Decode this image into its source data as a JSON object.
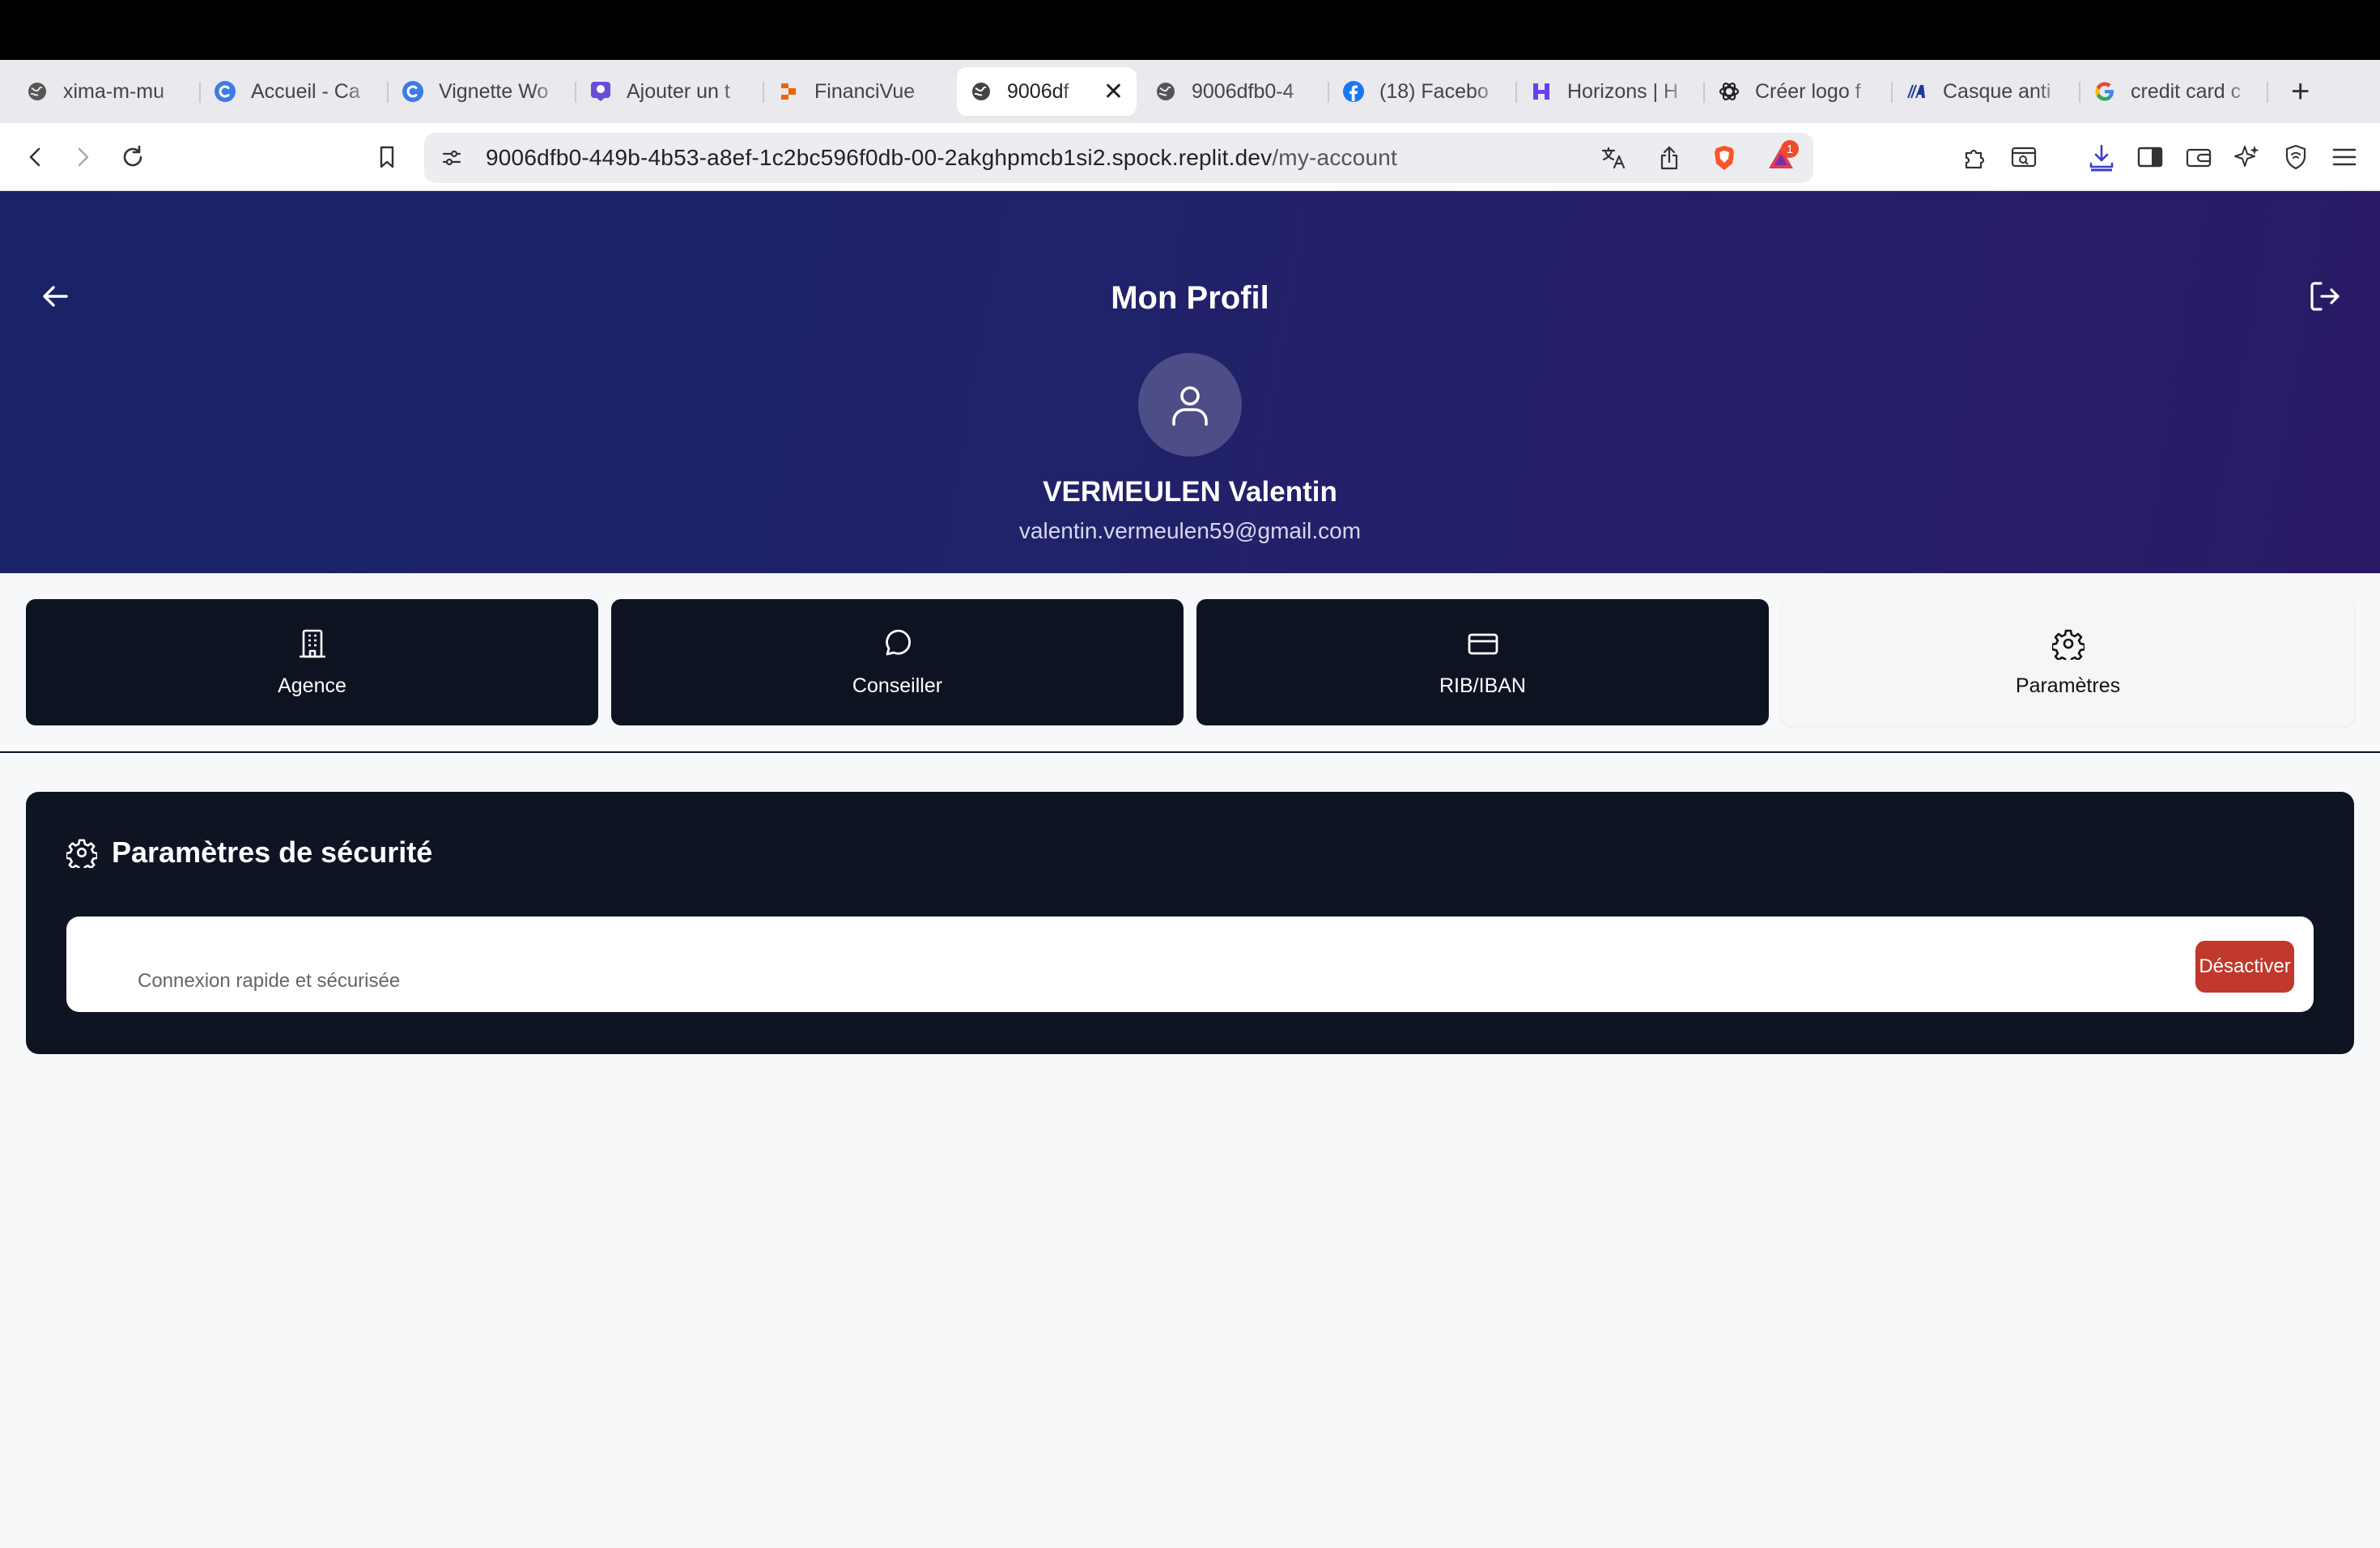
{
  "browser": {
    "tabs": [
      {
        "label": "xima-m-mu",
        "icon": "globe-icon"
      },
      {
        "label": "Accueil - Ca",
        "icon": "canva-icon"
      },
      {
        "label": "Vignette Wo",
        "icon": "canva-icon"
      },
      {
        "label": "Ajouter un t",
        "icon": "badge-icon"
      },
      {
        "label": "FinanciVue",
        "icon": "replit-icon"
      },
      {
        "label": "9006df",
        "icon": "globe-icon",
        "active": true
      },
      {
        "label": "9006dfb0-4",
        "icon": "globe-icon"
      },
      {
        "label": "(18) Facebo",
        "icon": "facebook-icon"
      },
      {
        "label": "Horizons | H",
        "icon": "horizons-icon"
      },
      {
        "label": "Créer logo f",
        "icon": "openai-icon"
      },
      {
        "label": "Casque anti",
        "icon": "brand-a-icon"
      },
      {
        "label": "credit card c",
        "icon": "google-icon"
      }
    ],
    "url_main": "9006dfb0-449b-4b53-a8ef-1c2bc596f0db-00-2akghpmcb1si2.spock.replit.dev",
    "url_path": "/my-account",
    "alert_badge": "1"
  },
  "header": {
    "title": "Mon Profil",
    "name": "VERMEULEN Valentin",
    "email": "valentin.vermeulen59@gmail.com"
  },
  "tabs": [
    {
      "label": "Agence",
      "icon": "building-icon"
    },
    {
      "label": "Conseiller",
      "icon": "chat-icon"
    },
    {
      "label": "RIB/IBAN",
      "icon": "credit-card-icon"
    },
    {
      "label": "Paramètres",
      "icon": "gear-icon",
      "selected": true
    }
  ],
  "security": {
    "title": "Paramètres de sécurité",
    "row_description": "Connexion rapide et sécurisée",
    "button_label": "Désactiver"
  }
}
